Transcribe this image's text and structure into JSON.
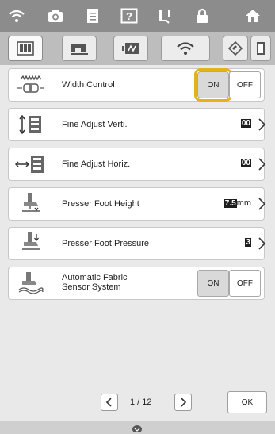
{
  "topbar": {
    "icons": [
      "wifi-icon",
      "camera-icon",
      "document-icon",
      "help-icon",
      "threading-icon",
      "lock-icon",
      "home-icon"
    ]
  },
  "tabs": {
    "icons": [
      "sewing-settings-icon",
      "machine-settings-icon",
      "display-settings-icon",
      "wifi-settings-icon",
      "eraser-icon",
      "info-icon"
    ]
  },
  "rows": [
    {
      "label": "Width Control",
      "on": "ON",
      "off": "OFF",
      "selected": "ON"
    },
    {
      "label": "Fine Adjust Verti.",
      "value": "00"
    },
    {
      "label": "Fine Adjust Horiz.",
      "value": "00"
    },
    {
      "label": "Presser Foot Height",
      "value": "7.5",
      "unit": "mm"
    },
    {
      "label": "Presser Foot Pressure",
      "value": "3"
    },
    {
      "label_line1": "Automatic Fabric",
      "label_line2": "Sensor System",
      "on": "ON",
      "off": "OFF"
    }
  ],
  "footer": {
    "page_text": "1  /  12",
    "ok_label": "OK"
  },
  "colors": {
    "topbar": "#8c8c8c",
    "tabrow": "#bdbdbd",
    "list_bg": "#e9e9e9",
    "selection": "#e3b21c"
  }
}
